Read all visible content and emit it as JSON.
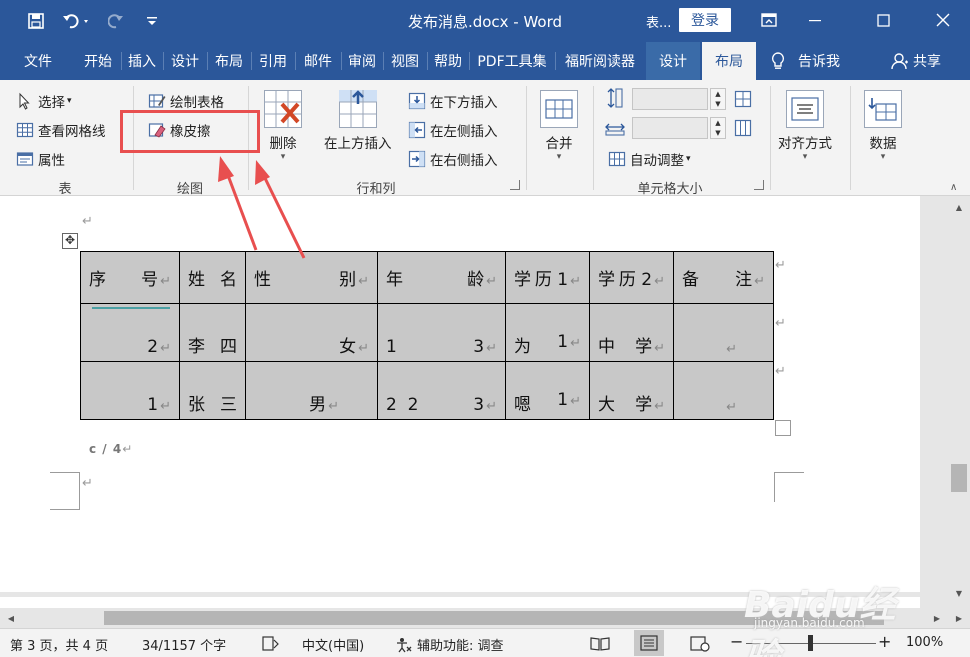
{
  "titlebar": {
    "title": "发布消息.docx - Word",
    "context_label": "表...",
    "login": "登录",
    "save_icon": "save-icon",
    "undo_icon": "undo-icon",
    "redo_icon": "redo-icon",
    "customize_icon": "customize-quick-access-icon"
  },
  "tabs": [
    {
      "label": "文件"
    },
    {
      "label": "开始"
    },
    {
      "label": "插入"
    },
    {
      "label": "设计"
    },
    {
      "label": "布局"
    },
    {
      "label": "引用"
    },
    {
      "label": "邮件"
    },
    {
      "label": "审阅"
    },
    {
      "label": "视图"
    },
    {
      "label": "帮助"
    },
    {
      "label": "PDF工具集"
    },
    {
      "label": "福昕阅读器"
    },
    {
      "label": "设计"
    },
    {
      "label": "布局"
    },
    {
      "label": "告诉我"
    },
    {
      "label": "共享"
    }
  ],
  "ribbon": {
    "table_group": {
      "select": "选择",
      "gridlines": "查看网格线",
      "properties": "属性",
      "label": "表"
    },
    "draw_group": {
      "draw_table": "绘制表格",
      "eraser": "橡皮擦",
      "label": "绘图"
    },
    "rows_cols_group": {
      "delete": "删除",
      "insert_above": "在上方插入",
      "insert_below": "在下方插入",
      "insert_left": "在左侧插入",
      "insert_right": "在右侧插入",
      "label": "行和列"
    },
    "merge_group": {
      "merge": "合并"
    },
    "cell_size_group": {
      "autofit": "自动调整",
      "label": "单元格大小"
    },
    "align_group": {
      "alignment": "对齐方式"
    },
    "data_group": {
      "data": "数据"
    }
  },
  "table": {
    "rows": [
      [
        {
          "a": "序",
          "b": "号"
        },
        {
          "a": "姓",
          "b": "名"
        },
        {
          "a": "性",
          "b": "别"
        },
        {
          "a": "年",
          "b": "龄"
        },
        {
          "a": "学",
          "b": "历 1"
        },
        {
          "a": "学",
          "b": "历 2"
        },
        {
          "a": "备",
          "b": "注"
        }
      ],
      [
        {
          "a": "",
          "b": "2"
        },
        {
          "a": "李",
          "b": "四"
        },
        {
          "a": "",
          "b": "女"
        },
        {
          "a": "1",
          "b": "3"
        },
        {
          "a": "为",
          "b": "1"
        },
        {
          "a": "中",
          "b": "学"
        },
        {
          "a": "",
          "b": ""
        }
      ],
      [
        {
          "a": "",
          "b": "1"
        },
        {
          "a": "张",
          "b": "三"
        },
        {
          "a": "",
          "b": "男"
        },
        {
          "a": "2  2",
          "b": "3"
        },
        {
          "a": "嗯",
          "b": "1"
        },
        {
          "a": "大",
          "b": "学"
        },
        {
          "a": "",
          "b": ""
        }
      ]
    ],
    "page_number": "c / 4"
  },
  "status": {
    "page": "第 3 页，共 4 页",
    "words": "34/1157 个字",
    "language": "中文(中国)",
    "accessibility": "辅助功能: 调查",
    "zoom": "100%",
    "zoom_minus": "−",
    "zoom_plus": "+"
  },
  "watermark": {
    "main": "Baidu经验",
    "sub": "jingyan.baidu.com"
  },
  "colors": {
    "brand": "#2b579a",
    "highlight": "#e84f4f"
  }
}
